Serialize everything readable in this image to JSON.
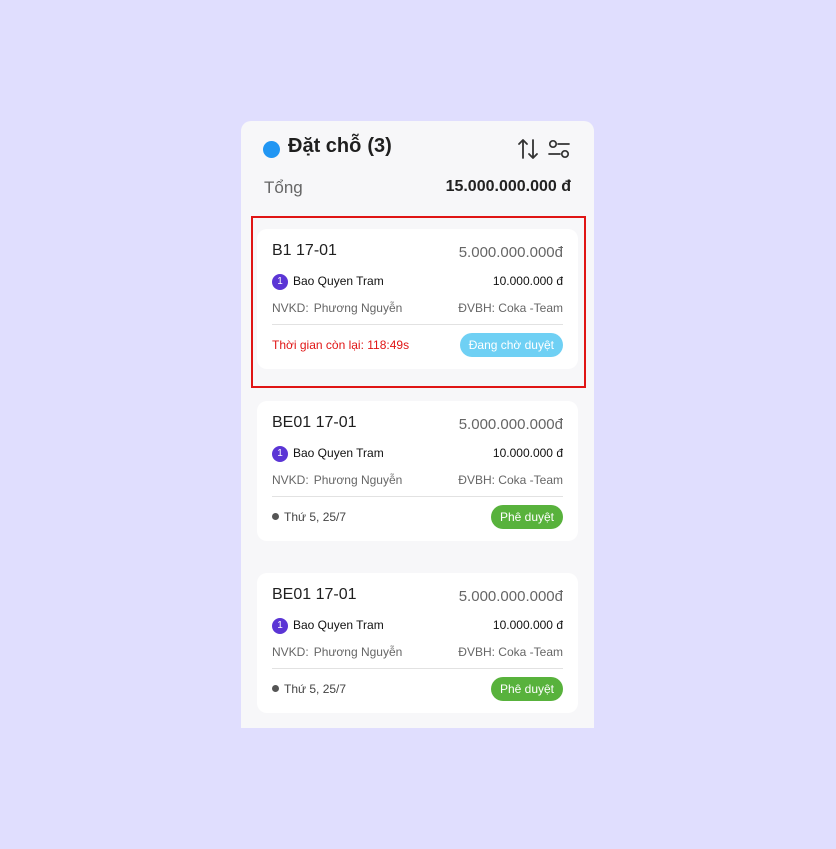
{
  "header": {
    "title": "Đặt chỗ",
    "count": "(3)",
    "total_label": "Tổng",
    "total_value": "15.000.000.000 đ"
  },
  "cards": [
    {
      "code": "B1 17-01",
      "amount": "5.000.000.000đ",
      "badge": "1",
      "customer": "Bao Quyen Tram",
      "fee": "10.000.000 đ",
      "nvkd_label": "NVKD:",
      "nvkd_value": "Phương Nguyễn",
      "dvbh": "ĐVBH: Coka -Team",
      "footer_text": "Thời gian còn lại: 118:49s",
      "status": "Đang chờ duyệt"
    },
    {
      "code": "BE01 17-01",
      "amount": "5.000.000.000đ",
      "badge": "1",
      "customer": "Bao Quyen Tram",
      "fee": "10.000.000 đ",
      "nvkd_label": "NVKD:",
      "nvkd_value": "Phương Nguyễn",
      "dvbh": "ĐVBH: Coka -Team",
      "footer_text": "Thứ 5, 25/7",
      "status": "Phê duyệt"
    },
    {
      "code": "BE01 17-01",
      "amount": "5.000.000.000đ",
      "badge": "1",
      "customer": "Bao Quyen Tram",
      "fee": "10.000.000 đ",
      "nvkd_label": "NVKD:",
      "nvkd_value": "Phương Nguyễn",
      "dvbh": "ĐVBH: Coka -Team",
      "footer_text": "Thứ 5, 25/7",
      "status": "Phê duyệt"
    }
  ],
  "colors": {
    "background": "#e0defe",
    "status_dot": "#2196f3",
    "badge": "#5b35d5",
    "timer": "#e01515",
    "pending": "#6fd0f4",
    "approved": "#58b23c",
    "highlight": "#e01515"
  },
  "icons": {
    "sort": "sort-arrows-icon",
    "filter": "filter-sliders-icon",
    "date_dot": "bullet-dot-icon"
  }
}
